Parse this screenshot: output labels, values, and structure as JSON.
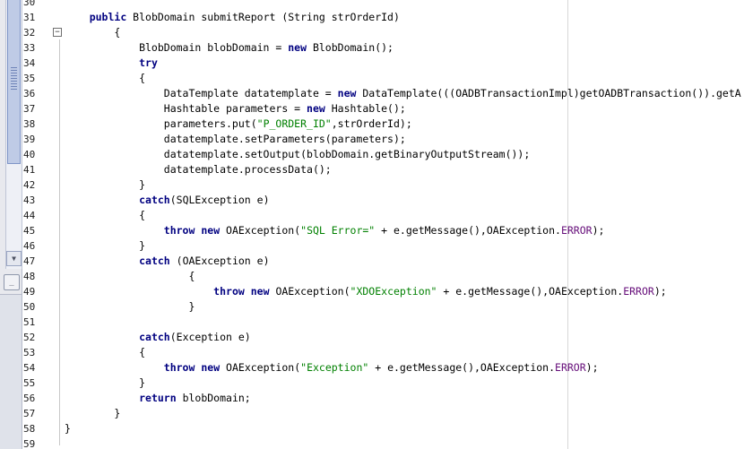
{
  "editor": {
    "lines": [
      {
        "n": "30",
        "segs": []
      },
      {
        "n": "31",
        "segs": [
          {
            "t": "    "
          },
          {
            "t": "public",
            "k": "kw"
          },
          {
            "t": " BlobDomain submitReport (String strOrderId)"
          }
        ]
      },
      {
        "n": "32",
        "segs": [
          {
            "t": "        {"
          }
        ]
      },
      {
        "n": "33",
        "segs": [
          {
            "t": "            BlobDomain blobDomain = "
          },
          {
            "t": "new",
            "k": "kw"
          },
          {
            "t": " BlobDomain();"
          }
        ]
      },
      {
        "n": "34",
        "segs": [
          {
            "t": "            "
          },
          {
            "t": "try",
            "k": "kw"
          }
        ]
      },
      {
        "n": "35",
        "segs": [
          {
            "t": "            {"
          }
        ]
      },
      {
        "n": "36",
        "segs": [
          {
            "t": "                DataTemplate datatemplate = "
          },
          {
            "t": "new",
            "k": "kw"
          },
          {
            "t": " DataTemplate(((OADBTransactionImpl)getOADBTransaction()).getA"
          }
        ]
      },
      {
        "n": "37",
        "segs": [
          {
            "t": "                Hashtable parameters = "
          },
          {
            "t": "new",
            "k": "kw"
          },
          {
            "t": " Hashtable();"
          }
        ]
      },
      {
        "n": "38",
        "segs": [
          {
            "t": "                parameters.put("
          },
          {
            "t": "\"P_ORDER_ID\"",
            "k": "str"
          },
          {
            "t": ",strOrderId);"
          }
        ]
      },
      {
        "n": "39",
        "segs": [
          {
            "t": "                datatemplate.setParameters(parameters);"
          }
        ]
      },
      {
        "n": "40",
        "segs": [
          {
            "t": "                datatemplate.setOutput(blobDomain.getBinaryOutputStream());"
          }
        ]
      },
      {
        "n": "41",
        "segs": [
          {
            "t": "                datatemplate.processData();"
          }
        ]
      },
      {
        "n": "42",
        "segs": [
          {
            "t": "            }"
          }
        ]
      },
      {
        "n": "43",
        "segs": [
          {
            "t": "            "
          },
          {
            "t": "catch",
            "k": "kw"
          },
          {
            "t": "(SQLException e)"
          }
        ]
      },
      {
        "n": "44",
        "segs": [
          {
            "t": "            {"
          }
        ]
      },
      {
        "n": "45",
        "segs": [
          {
            "t": "                "
          },
          {
            "t": "throw",
            "k": "kw"
          },
          {
            "t": " "
          },
          {
            "t": "new",
            "k": "kw"
          },
          {
            "t": " OAException("
          },
          {
            "t": "\"SQL Error=\"",
            "k": "str"
          },
          {
            "t": " + e.getMessage(),OAException."
          },
          {
            "t": "ERROR",
            "k": "field"
          },
          {
            "t": ");"
          }
        ]
      },
      {
        "n": "46",
        "segs": [
          {
            "t": "            }"
          }
        ]
      },
      {
        "n": "47",
        "segs": [
          {
            "t": "            "
          },
          {
            "t": "catch",
            "k": "kw"
          },
          {
            "t": " (OAException e)"
          }
        ]
      },
      {
        "n": "48",
        "segs": [
          {
            "t": "                    {"
          }
        ]
      },
      {
        "n": "49",
        "segs": [
          {
            "t": "                        "
          },
          {
            "t": "throw",
            "k": "kw"
          },
          {
            "t": " "
          },
          {
            "t": "new",
            "k": "kw"
          },
          {
            "t": " OAException("
          },
          {
            "t": "\"XDOException\"",
            "k": "str"
          },
          {
            "t": " + e.getMessage(),OAException."
          },
          {
            "t": "ERROR",
            "k": "field"
          },
          {
            "t": ");"
          }
        ]
      },
      {
        "n": "50",
        "segs": [
          {
            "t": "                    }"
          }
        ]
      },
      {
        "n": "51",
        "segs": []
      },
      {
        "n": "52",
        "segs": [
          {
            "t": "            "
          },
          {
            "t": "catch",
            "k": "kw"
          },
          {
            "t": "(Exception e)"
          }
        ]
      },
      {
        "n": "53",
        "segs": [
          {
            "t": "            {"
          }
        ]
      },
      {
        "n": "54",
        "segs": [
          {
            "t": "                "
          },
          {
            "t": "throw",
            "k": "kw"
          },
          {
            "t": " "
          },
          {
            "t": "new",
            "k": "kw"
          },
          {
            "t": " OAException("
          },
          {
            "t": "\"Exception\"",
            "k": "str"
          },
          {
            "t": " + e.getMessage(),OAException."
          },
          {
            "t": "ERROR",
            "k": "field"
          },
          {
            "t": ");"
          }
        ]
      },
      {
        "n": "55",
        "segs": [
          {
            "t": "            }"
          }
        ]
      },
      {
        "n": "56",
        "segs": [
          {
            "t": "            "
          },
          {
            "t": "return",
            "k": "kw"
          },
          {
            "t": " blobDomain;"
          }
        ]
      },
      {
        "n": "57",
        "segs": [
          {
            "t": "        }"
          }
        ]
      },
      {
        "n": "58",
        "segs": [
          {
            "t": "}"
          }
        ]
      },
      {
        "n": "59",
        "segs": []
      }
    ]
  },
  "fold": {
    "symbol": "−"
  },
  "scroll": {
    "down_arrow": "▼",
    "minimize": "_"
  },
  "colors": {
    "keyword": "#000080",
    "string": "#008000",
    "field": "#660e7a"
  }
}
